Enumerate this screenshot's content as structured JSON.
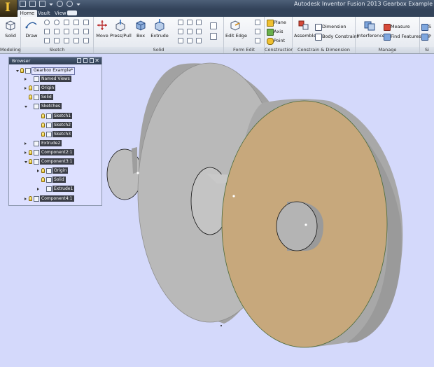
{
  "titlebar": {
    "app_letter": "I",
    "title": "Autodesk Inventor Fusion 2013   Gearbox Example"
  },
  "tabs": [
    {
      "label": "Home",
      "active": true
    },
    {
      "label": "Vault",
      "active": false
    },
    {
      "label": "View",
      "active": false
    }
  ],
  "ribbon": {
    "modeling": {
      "title": "Modeling",
      "solid": "Solid"
    },
    "sketch": {
      "title": "Sketch",
      "draw": "Draw"
    },
    "solid": {
      "title": "Solid",
      "move": "Move",
      "press_pull": "Press/Pull",
      "box": "Box",
      "extrude": "Extrude"
    },
    "form_edit": {
      "title": "Form Edit",
      "edit_edge": "Edit Edge"
    },
    "construction": {
      "title": "Construction",
      "plane": "Plane",
      "axis": "Axis",
      "point": "Point"
    },
    "constrain": {
      "title": "Constrain & Dimension",
      "assemble": "Assemble",
      "dimension": "Dimension",
      "body_constraint": "Body Constraint"
    },
    "manage": {
      "title": "Manage",
      "interference": "Interference",
      "measure": "Measure",
      "find_features": "Find Features"
    },
    "extra": {
      "title": "Si",
      "item1": "S",
      "item2": "P"
    }
  },
  "browser": {
    "title": "Browser",
    "nodes": [
      {
        "label": "Gearbox Example*",
        "level": 0,
        "toggle": "exp",
        "bulb": true,
        "root": true
      },
      {
        "label": "Named Views",
        "level": 1,
        "toggle": "col",
        "bulb": false
      },
      {
        "label": "Origin",
        "level": 1,
        "toggle": "col",
        "bulb": true
      },
      {
        "label": "Solid",
        "level": 1,
        "toggle": "",
        "bulb": true
      },
      {
        "label": "Sketches",
        "level": 1,
        "toggle": "exp",
        "bulb": false
      },
      {
        "label": "Sketch1",
        "level": 2,
        "toggle": "",
        "bulb": true
      },
      {
        "label": "Sketch2",
        "level": 2,
        "toggle": "",
        "bulb": true
      },
      {
        "label": "Sketch3",
        "level": 2,
        "toggle": "",
        "bulb": true
      },
      {
        "label": "Extrude2",
        "level": 1,
        "toggle": "col",
        "bulb": false
      },
      {
        "label": "Component2:1",
        "level": 1,
        "toggle": "col",
        "bulb": true
      },
      {
        "label": "Component3:1",
        "level": 1,
        "toggle": "exp",
        "bulb": true
      },
      {
        "label": "Origin",
        "level": 2,
        "toggle": "col",
        "bulb": true
      },
      {
        "label": "Solid",
        "level": 2,
        "toggle": "",
        "bulb": true
      },
      {
        "label": "Extrude1",
        "level": 2,
        "toggle": "col",
        "bulb": false
      },
      {
        "label": "Component4:1",
        "level": 1,
        "toggle": "col",
        "bulb": true
      }
    ]
  },
  "viewport": {
    "background": "#d4d9fb",
    "gray_face": "#b9b9b9",
    "gray_edge": "#a2a2a2",
    "gold_face": "#c7a87c",
    "gold_edge": "#a8a8a8"
  }
}
